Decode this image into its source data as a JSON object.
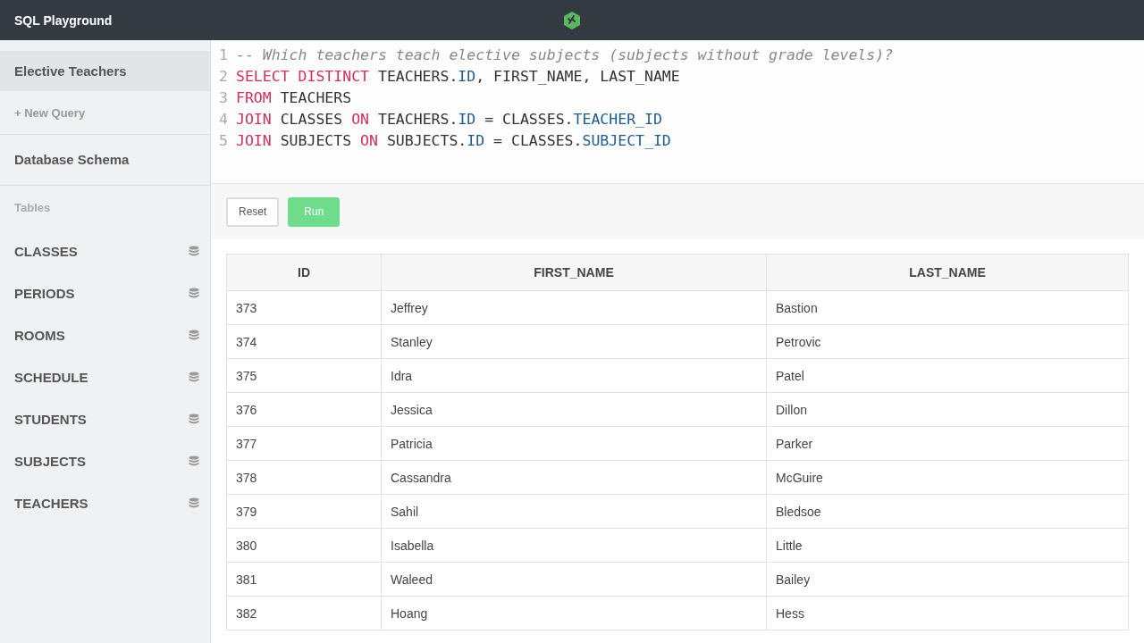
{
  "app": {
    "title": "SQL Playground"
  },
  "sidebar": {
    "queries": [
      {
        "label": "Elective Teachers",
        "selected": true
      }
    ],
    "new_query": "+ New Query",
    "schema_title": "Database Schema",
    "tables_heading": "Tables",
    "tables": [
      "CLASSES",
      "PERIODS",
      "ROOMS",
      "SCHEDULE",
      "STUDENTS",
      "SUBJECTS",
      "TEACHERS"
    ]
  },
  "editor": {
    "lines": [
      {
        "number": "1",
        "tokens": [
          {
            "kind": "comment",
            "text": "-- Which teachers teach elective subjects (subjects without grade levels)?"
          }
        ]
      },
      {
        "number": "2",
        "tokens": [
          {
            "kind": "keyword",
            "text": "SELECT DISTINCT"
          },
          {
            "kind": "plain",
            "text": " TEACHERS."
          },
          {
            "kind": "prop",
            "text": "ID"
          },
          {
            "kind": "plain",
            "text": ", FIRST_NAME, LAST_NAME"
          }
        ]
      },
      {
        "number": "3",
        "tokens": [
          {
            "kind": "keyword",
            "text": "FROM"
          },
          {
            "kind": "plain",
            "text": " TEACHERS"
          }
        ]
      },
      {
        "number": "4",
        "tokens": [
          {
            "kind": "keyword",
            "text": "JOIN"
          },
          {
            "kind": "plain",
            "text": " CLASSES "
          },
          {
            "kind": "keyword",
            "text": "ON"
          },
          {
            "kind": "plain",
            "text": " TEACHERS."
          },
          {
            "kind": "prop",
            "text": "ID"
          },
          {
            "kind": "plain",
            "text": " = CLASSES."
          },
          {
            "kind": "prop",
            "text": "TEACHER_ID"
          }
        ]
      },
      {
        "number": "5",
        "tokens": [
          {
            "kind": "keyword",
            "text": "JOIN"
          },
          {
            "kind": "plain",
            "text": " SUBJECTS "
          },
          {
            "kind": "keyword",
            "text": "ON"
          },
          {
            "kind": "plain",
            "text": " SUBJECTS."
          },
          {
            "kind": "prop",
            "text": "ID"
          },
          {
            "kind": "plain",
            "text": " = CLASSES."
          },
          {
            "kind": "prop",
            "text": "SUBJECT_ID"
          }
        ]
      }
    ]
  },
  "buttons": [
    {
      "label": "Reset",
      "kind": "secondary"
    },
    {
      "label": "Run",
      "kind": "primary"
    }
  ],
  "table": {
    "columns": [
      "ID",
      "FIRST_NAME",
      "LAST_NAME"
    ],
    "rows": [
      [
        "373",
        "Jeffrey",
        "Bastion"
      ],
      [
        "374",
        "Stanley",
        "Petrovic"
      ],
      [
        "375",
        "Idra",
        "Patel"
      ],
      [
        "376",
        "Jessica",
        "Dillon"
      ],
      [
        "377",
        "Patricia",
        "Parker"
      ],
      [
        "378",
        "Cassandra",
        "McGuire"
      ],
      [
        "379",
        "Sahil",
        "Bledsoe"
      ],
      [
        "380",
        "Isabella",
        "Little"
      ],
      [
        "381",
        "Waleed",
        "Bailey"
      ],
      [
        "382",
        "Hoang",
        "Hess"
      ]
    ]
  }
}
